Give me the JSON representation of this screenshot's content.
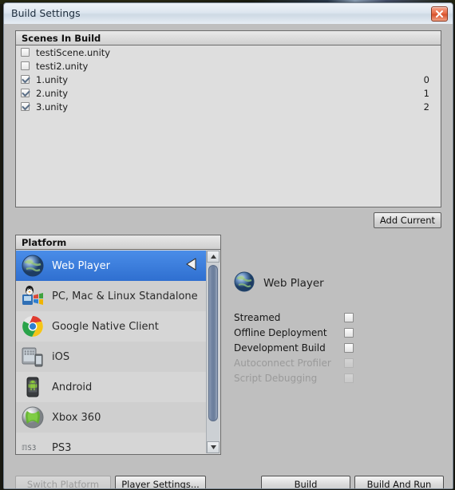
{
  "window": {
    "title": "Build Settings",
    "close_icon": "close-icon"
  },
  "scenes_panel": {
    "header": "Scenes In Build",
    "scenes": [
      {
        "name": "testiScene.unity",
        "checked": false,
        "index": ""
      },
      {
        "name": "testi2.unity",
        "checked": false,
        "index": ""
      },
      {
        "name": "1.unity",
        "checked": true,
        "index": "0"
      },
      {
        "name": "2.unity",
        "checked": true,
        "index": "1"
      },
      {
        "name": "3.unity",
        "checked": true,
        "index": "2"
      }
    ],
    "add_current_label": "Add Current"
  },
  "platform_panel": {
    "header": "Platform",
    "platforms": [
      {
        "label": "Web Player",
        "icon": "globe-icon",
        "selected": true,
        "active_marker": "unity-logo-icon"
      },
      {
        "label": "PC, Mac & Linux Standalone",
        "icon": "standalone-icon",
        "selected": false
      },
      {
        "label": "Google Native Client",
        "icon": "chrome-icon",
        "selected": false
      },
      {
        "label": "iOS",
        "icon": "ios-device-icon",
        "selected": false
      },
      {
        "label": "Android",
        "icon": "android-icon",
        "selected": false
      },
      {
        "label": "Xbox 360",
        "icon": "xbox-icon",
        "selected": false
      },
      {
        "label": "PS3",
        "icon": "ps3-icon",
        "selected": false
      }
    ],
    "scrollbar": {
      "up_arrow": "scroll-up-icon",
      "down_arrow": "scroll-down-icon"
    }
  },
  "settings_panel": {
    "target_name": "Web Player",
    "target_icon": "globe-icon",
    "options": [
      {
        "label": "Streamed",
        "checked": false,
        "enabled": true
      },
      {
        "label": "Offline Deployment",
        "checked": false,
        "enabled": true
      },
      {
        "label": "Development Build",
        "checked": false,
        "enabled": true
      },
      {
        "label": "Autoconnect Profiler",
        "checked": false,
        "enabled": false
      },
      {
        "label": "Script Debugging",
        "checked": false,
        "enabled": false
      }
    ]
  },
  "footer": {
    "switch_platform_label": "Switch Platform",
    "switch_platform_enabled": false,
    "player_settings_label": "Player Settings...",
    "build_label": "Build",
    "build_and_run_label": "Build And Run"
  },
  "colors": {
    "selection_blue": "#2f6fd0",
    "dialog_grey": "#bfbfbf",
    "panel_grey": "#dedede",
    "close_red": "#d8522d"
  }
}
